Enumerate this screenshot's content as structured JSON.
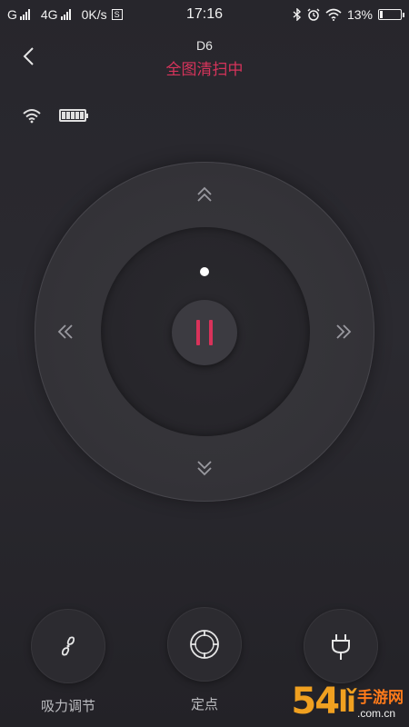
{
  "status_bar": {
    "carrier": "G",
    "network": "4G",
    "speed": "0K/s",
    "s_badge": "S",
    "time": "17:16",
    "battery": "13%",
    "battery_level": 0.13,
    "icons": [
      "signal-icon",
      "bluetooth-icon",
      "alarm-icon",
      "wifi-icon",
      "battery-icon"
    ]
  },
  "header": {
    "title": "D6",
    "subtitle": "全图清扫中",
    "back_icon": "chevron-left-icon"
  },
  "device_status": {
    "wifi_icon": "wifi-icon",
    "battery_icon": "battery-full-icon"
  },
  "control_pad": {
    "up_icon": "double-chevron-up-icon",
    "down_icon": "double-chevron-down-icon",
    "left_icon": "double-chevron-left-icon",
    "right_icon": "double-chevron-right-icon",
    "center_icon": "pause-icon",
    "accent_color": "#d9325a"
  },
  "actions": [
    {
      "label": "吸力调节",
      "icon": "fan-icon"
    },
    {
      "label": "定点",
      "icon": "spot-target-icon"
    },
    {
      "label": "",
      "icon": "plug-icon"
    }
  ],
  "watermark": {
    "num": "54",
    "glyph": "lǐ",
    "text": "手游网",
    "url": ".com.cn"
  }
}
